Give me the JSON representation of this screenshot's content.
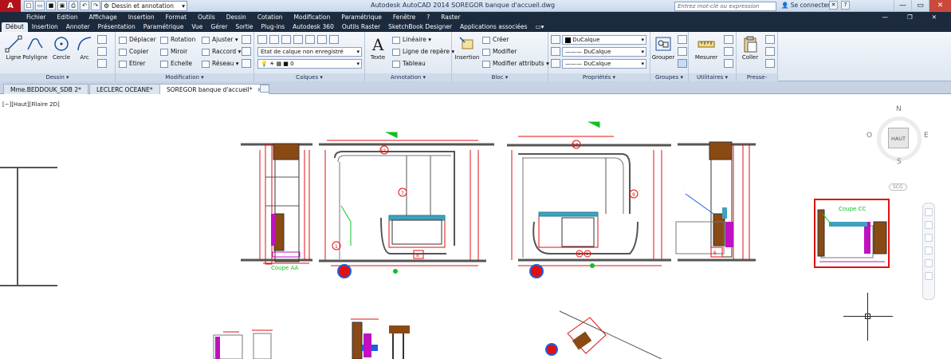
{
  "titlebar": {
    "logo": "A",
    "workspace": "Dessin et annotation",
    "title": "Autodesk AutoCAD 2014   SOREGOR banque d'accueil.dwg",
    "search_placeholder": "Entrez mot-clé ou expression",
    "connect": "Se connecter"
  },
  "menu": [
    "Fichier",
    "Edition",
    "Affichage",
    "Insertion",
    "Format",
    "Outils",
    "Dessin",
    "Cotation",
    "Modification",
    "Paramétrique",
    "Fenêtre",
    "?",
    "Raster"
  ],
  "ribbon_tabs": [
    "Début",
    "Insertion",
    "Annoter",
    "Présentation",
    "Paramétrique",
    "Vue",
    "Gérer",
    "Sortie",
    "Plug-ins",
    "Autodesk 360",
    "Outils Raster",
    "SketchBook Designer",
    "Applications associées"
  ],
  "active_tab": "Début",
  "panels": {
    "dessin": {
      "title": "Dessin",
      "tools": [
        "Ligne",
        "Polyligne",
        "Cercle",
        "Arc"
      ]
    },
    "modification": {
      "title": "Modification",
      "tools": [
        "Déplacer",
        "Rotation",
        "Ajuster",
        "Copier",
        "Miroir",
        "Raccord",
        "Etirer",
        "Echelle",
        "Réseau"
      ]
    },
    "calques": {
      "title": "Calques",
      "state": "Etat de calque non enregistré",
      "current": "0"
    },
    "annotation": {
      "title": "Annotation",
      "texte": "Texte",
      "lineaire": "Linéaire",
      "ligne_repere": "Ligne de repère",
      "tableau": "Tableau"
    },
    "bloc": {
      "title": "Bloc",
      "insertion": "Insertion",
      "creer": "Créer",
      "modifier": "Modifier",
      "modifier_attributs": "Modifier attributs"
    },
    "proprietes": {
      "title": "Propriétés",
      "couleur": "DuCalque",
      "type_ligne": "DuCalque",
      "epaisseur": "DuCalque"
    },
    "groupes": {
      "title": "Groupes",
      "grouper": "Grouper"
    },
    "utilitaires": {
      "title": "Utilitaires",
      "mesurer": "Mesurer"
    },
    "presse_papiers": {
      "title": "Presse-papiers",
      "coller": "Coller"
    }
  },
  "doc_tabs": [
    "Mme.BEDDOUK_SDB 2*",
    "LECLERC OCEANE*",
    "SOREGOR banque d'accueil*"
  ],
  "active_doc": "SOREGOR banque d'accueil*",
  "viewport_label": "[−][Haut][Filaire 2D]",
  "viewcube": {
    "n": "N",
    "s": "S",
    "e": "E",
    "o": "O",
    "face": "HAUT",
    "ucs": "SCG"
  },
  "drawing_labels": {
    "coupe_aa": "Coupe AA",
    "coupe_cc": "Coupe CC",
    "markers": [
      "11",
      "10",
      "7",
      "9",
      "1",
      "8",
      "2",
      "3",
      "6"
    ]
  },
  "colors": {
    "accent": "#b3121a",
    "menubar": "#1c2a3d",
    "ribbon": "#dde6f1",
    "cad_red": "#e01010",
    "cad_green": "#10c020",
    "cad_magenta": "#c010c0",
    "cad_brown": "#8a4a14"
  }
}
